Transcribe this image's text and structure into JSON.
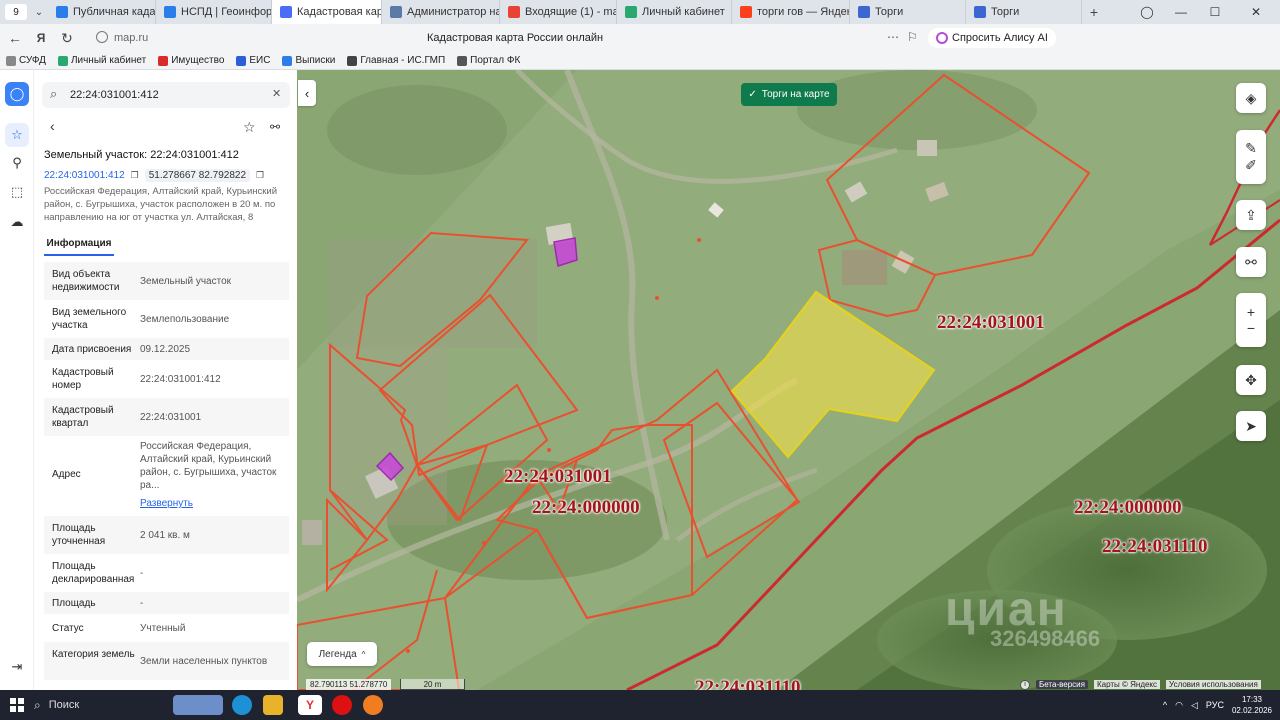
{
  "browser": {
    "tab_count": "9",
    "tabs": [
      {
        "label": "Публичная кадастро",
        "color": "#2b7de9"
      },
      {
        "label": "НСПД | Геоинформа",
        "color": "#2b7de9"
      },
      {
        "label": "Кадастровая карт",
        "color": "#4a6cf7",
        "active": true
      },
      {
        "label": "Администратор нач",
        "color": "#5a7aa8"
      },
      {
        "label": "Входящие (1) - maria",
        "color": "#e94235"
      },
      {
        "label": "Личный кабинет",
        "color": "#2aa86f"
      },
      {
        "label": "торги гов — Яндекс:",
        "color": "#fc3f1d"
      },
      {
        "label": "Торги",
        "color": "#3b67d1"
      },
      {
        "label": "Торги",
        "color": "#3b67d1"
      }
    ],
    "url": "map.ru",
    "page_title": "Кадастровая карта России онлайн",
    "alice_label": "Спросить Алису AI",
    "bookmarks": [
      {
        "label": "СУФД",
        "color": "#888"
      },
      {
        "label": "Личный кабинет",
        "color": "#2aa86f"
      },
      {
        "label": "Имущество",
        "color": "#d92b2b"
      },
      {
        "label": "ЕИС",
        "color": "#2b5fd9"
      },
      {
        "label": "Выписки",
        "color": "#2b7de9"
      },
      {
        "label": "Главная - ИС.ГМП",
        "color": "#444"
      },
      {
        "label": "Портал ФК",
        "color": "#555"
      }
    ]
  },
  "search": {
    "value": "22:24:031001:412"
  },
  "parcel": {
    "title": "Земельный участок: 22:24:031001:412",
    "cad_number": "22:24:031001:412",
    "coords": "51.278667 82.792822",
    "address_summary": "Российская Федерация, Алтайский край, Курьинский район, с. Бугрышиха, участок расположен в 20 м. по направлению на юг от участка ул. Алтайская, 8",
    "tab_info": "Информация",
    "fields": [
      {
        "label": "Вид объекта недвижимости",
        "value": "Земельный участок"
      },
      {
        "label": "Вид земельного участка",
        "value": "Землепользование"
      },
      {
        "label": "Дата присвоения",
        "value": "09.12.2025"
      },
      {
        "label": "Кадастровый номер",
        "value": "22:24:031001:412"
      },
      {
        "label": "Кадастровый квартал",
        "value": "22:24:031001"
      },
      {
        "label": "Адрес",
        "value": "Российская Федерация, Алтайский край, Курьинский район, с. Бугрышиха, участок ра..."
      },
      {
        "label": "Площадь уточненная",
        "value": "2 041 кв. м"
      },
      {
        "label": "Площадь декларированная",
        "value": "-"
      },
      {
        "label": "Площадь",
        "value": "-"
      },
      {
        "label": "Статус",
        "value": "Учтенный"
      },
      {
        "label": "Категория земель",
        "value": "Земли населенных пунктов"
      }
    ],
    "expand_label": "Развернуть"
  },
  "map": {
    "torgi_label": "Торги на карте",
    "legend_label": "Легенда",
    "coords_readout": "82.790113  51.278770",
    "scale_label": "20 m",
    "beta_label": "Бета-версия",
    "maps_credit": "Карты © Яндекс",
    "terms_label": "Условия использования",
    "watermark": "циан",
    "watermark_id": "326498466",
    "labels": [
      "22:24:031001",
      "22:24:031001",
      "22:24:000000",
      "22:24:000000",
      "22:24:031110",
      "22:24:031110"
    ]
  },
  "taskbar": {
    "search_label": "Поиск",
    "lang": "РУС",
    "time": "17:33",
    "date": "02.02.2026"
  }
}
